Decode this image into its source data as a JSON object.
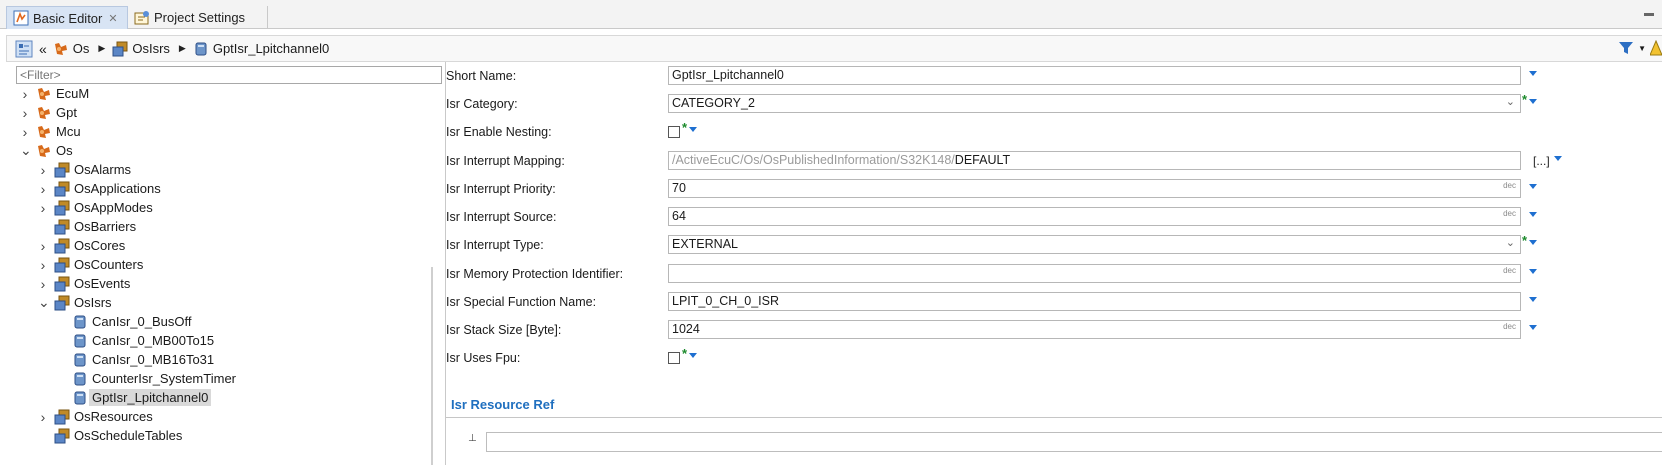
{
  "tabs": [
    {
      "label": "Basic Editor",
      "active": true,
      "icon": "basic-editor-icon"
    },
    {
      "label": "Project Settings",
      "active": false,
      "icon": "project-settings-icon"
    }
  ],
  "breadcrumb": {
    "items": [
      "Os",
      "OsIsrs",
      "GptIsr_Lpitchannel0"
    ]
  },
  "filter": {
    "placeholder": "<Filter>"
  },
  "tree": {
    "items": [
      {
        "label": "EcuM",
        "expanded": false,
        "level": 0,
        "icon": "module-icon"
      },
      {
        "label": "Gpt",
        "expanded": false,
        "level": 0,
        "icon": "module-icon"
      },
      {
        "label": "Mcu",
        "expanded": false,
        "level": 0,
        "icon": "module-icon"
      },
      {
        "label": "Os",
        "expanded": true,
        "level": 0,
        "icon": "module-icon"
      },
      {
        "label": "OsAlarms",
        "expanded": false,
        "level": 1,
        "icon": "container-icon"
      },
      {
        "label": "OsApplications",
        "expanded": false,
        "level": 1,
        "icon": "container-icon"
      },
      {
        "label": "OsAppModes",
        "expanded": false,
        "level": 1,
        "icon": "container-icon"
      },
      {
        "label": "OsBarriers",
        "expanded": null,
        "level": 1,
        "icon": "container-icon"
      },
      {
        "label": "OsCores",
        "expanded": false,
        "level": 1,
        "icon": "container-icon"
      },
      {
        "label": "OsCounters",
        "expanded": false,
        "level": 1,
        "icon": "container-icon"
      },
      {
        "label": "OsEvents",
        "expanded": false,
        "level": 1,
        "icon": "container-icon"
      },
      {
        "label": "OsIsrs",
        "expanded": true,
        "level": 1,
        "icon": "container-icon"
      },
      {
        "label": "CanIsr_0_BusOff",
        "expanded": null,
        "level": 2,
        "icon": "instance-icon"
      },
      {
        "label": "CanIsr_0_MB00To15",
        "expanded": null,
        "level": 2,
        "icon": "instance-icon"
      },
      {
        "label": "CanIsr_0_MB16To31",
        "expanded": null,
        "level": 2,
        "icon": "instance-icon"
      },
      {
        "label": "CounterIsr_SystemTimer",
        "expanded": null,
        "level": 2,
        "icon": "instance-icon"
      },
      {
        "label": "GptIsr_Lpitchannel0",
        "expanded": null,
        "level": 2,
        "icon": "instance-icon",
        "selected": true
      },
      {
        "label": "OsResources",
        "expanded": false,
        "level": 1,
        "icon": "container-icon"
      },
      {
        "label": "OsScheduleTables",
        "expanded": null,
        "level": 1,
        "icon": "container-icon"
      }
    ]
  },
  "form": {
    "fields": [
      {
        "label": "Short Name:",
        "value": "GptIsr_Lpitchannel0",
        "kind": "text"
      },
      {
        "label": "Isr Category:",
        "value": "CATEGORY_2",
        "kind": "combo"
      },
      {
        "label": "Isr Enable Nesting:",
        "value": "",
        "kind": "checkbox",
        "checked": false
      },
      {
        "label": "Isr Interrupt Mapping:",
        "value_prefix": "/ActiveEcuC/Os/OsPublishedInformation/S32K148/",
        "value": "DEFAULT",
        "kind": "reference",
        "more": "[...]"
      },
      {
        "label": "Isr Interrupt Priority:",
        "value": "70",
        "kind": "number",
        "unit": "dec"
      },
      {
        "label": "Isr Interrupt Source:",
        "value": "64",
        "kind": "number",
        "unit": "dec"
      },
      {
        "label": "Isr Interrupt Type:",
        "value": "EXTERNAL",
        "kind": "combo"
      },
      {
        "label": "Isr Memory Protection Identifier:",
        "value": "",
        "kind": "number",
        "unit": "dec"
      },
      {
        "label": "Isr Special Function Name:",
        "value": "LPIT_0_CH_0_ISR",
        "kind": "text"
      },
      {
        "label": "Isr Stack Size [Byte]:",
        "value": "1024",
        "kind": "number",
        "unit": "dec"
      },
      {
        "label": "Isr Uses Fpu:",
        "value": "",
        "kind": "checkbox",
        "checked": false
      }
    ],
    "section_title": "Isr Resource Ref"
  },
  "colors": {
    "accent": "#1e6fd0",
    "section": "#1f6fbf",
    "derived_star": "#1c8a2c"
  }
}
